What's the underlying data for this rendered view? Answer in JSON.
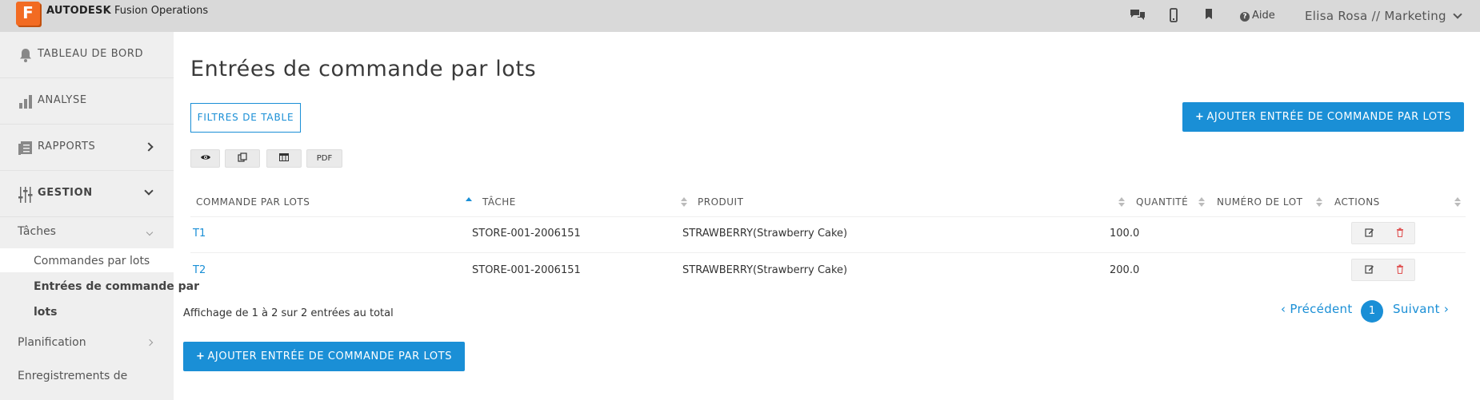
{
  "app": {
    "logo_letter": "F",
    "brand_bold": "AUTODESK",
    "brand_rest": "Fusion Operations",
    "help_label": "Aide",
    "user_label": "Elisa Rosa // Marketing",
    "icons": [
      "chat-icon",
      "mobile-icon",
      "bookmark-icon",
      "help-icon"
    ]
  },
  "sidebar": {
    "items": [
      {
        "label": "TABLEAU DE BORD",
        "icon": "bell-icon"
      },
      {
        "label": "ANALYSE",
        "icon": "bar-chart-icon"
      },
      {
        "label": "RAPPORTS",
        "icon": "report-icon"
      },
      {
        "label": "GESTION",
        "icon": "sliders-icon"
      }
    ],
    "sub": {
      "taches": "Tâches",
      "commandes": "Commandes par lots",
      "entrees_line1": "Entrées de commande par",
      "entrees_line2": "lots",
      "planification": "Planification",
      "enregistrements": "Enregistrements de"
    }
  },
  "main": {
    "title": "Entrées de commande par lots",
    "filters_button": "FILTRES DE TABLE",
    "add_button": "AJOUTER ENTRÉE DE COMMANDE PAR LOTS",
    "tools": {
      "pdf": "PDF"
    },
    "table": {
      "headers": [
        "COMMANDE PAR LOTS",
        "TÂCHE",
        "PRODUIT",
        "QUANTITÉ",
        "NUMÉRO DE LOT",
        "ACTIONS"
      ],
      "rows": [
        {
          "commande": "T1",
          "tache": "STORE-001-2006151",
          "produit": "STRAWBERRY(Strawberry Cake)",
          "quantite": "100.0",
          "numero": ""
        },
        {
          "commande": "T2",
          "tache": "STORE-001-2006151",
          "produit": "STRAWBERRY(Strawberry Cake)",
          "quantite": "200.0",
          "numero": ""
        }
      ]
    },
    "footer": "Affichage de 1 à 2 sur  2 entrées au total",
    "pager": {
      "prev": "‹ Précédent",
      "current": "1",
      "next": "Suivant ›"
    }
  },
  "colors": {
    "accent": "#1a8fd6",
    "logo": "#f26b22",
    "topbar": "#d9d9d9",
    "sidebar": "#efefef",
    "delete": "#e05555"
  }
}
